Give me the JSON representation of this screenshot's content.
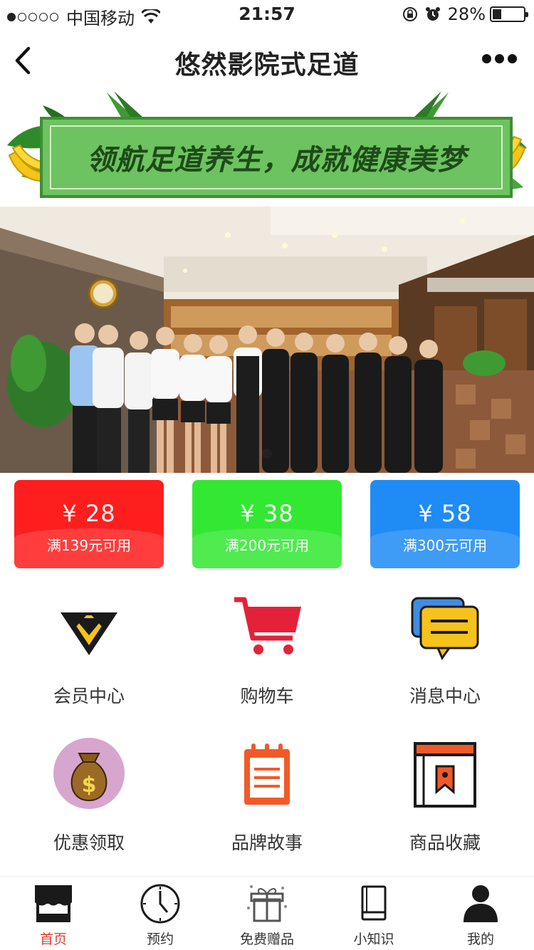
{
  "status_bar": {
    "carrier": "中国移动",
    "time": "21:57",
    "battery": "28%",
    "battery_level": 0.28
  },
  "nav": {
    "title": "悠然影院式足道"
  },
  "banner": {
    "slogan": "领航足道养生，成就健康美梦"
  },
  "carousel": {
    "current": 1,
    "total": 1
  },
  "coupons": [
    {
      "amount": "¥ 28",
      "condition": "满139元可用",
      "color": "#ff1e1e"
    },
    {
      "amount": "¥ 38",
      "condition": "满200元可用",
      "color": "#33e833"
    },
    {
      "amount": "¥ 58",
      "condition": "满300元可用",
      "color": "#1f8bf5"
    }
  ],
  "grid": [
    {
      "label": "会员中心",
      "icon": "diamond-icon"
    },
    {
      "label": "购物车",
      "icon": "cart-icon"
    },
    {
      "label": "消息中心",
      "icon": "message-icon"
    },
    {
      "label": "优惠领取",
      "icon": "money-bag-icon"
    },
    {
      "label": "品牌故事",
      "icon": "notepad-icon"
    },
    {
      "label": "商品收藏",
      "icon": "bookmark-window-icon"
    }
  ],
  "tabs": [
    {
      "label": "首页",
      "icon": "store-icon",
      "active": true
    },
    {
      "label": "预约",
      "icon": "clock-icon",
      "active": false
    },
    {
      "label": "免费赠品",
      "icon": "gift-icon",
      "active": false
    },
    {
      "label": "小知识",
      "icon": "book-icon",
      "active": false
    },
    {
      "label": "我的",
      "icon": "user-icon",
      "active": false
    }
  ],
  "colors": {
    "accent": "#e23b2e",
    "banner_green": "#6cc35f"
  }
}
